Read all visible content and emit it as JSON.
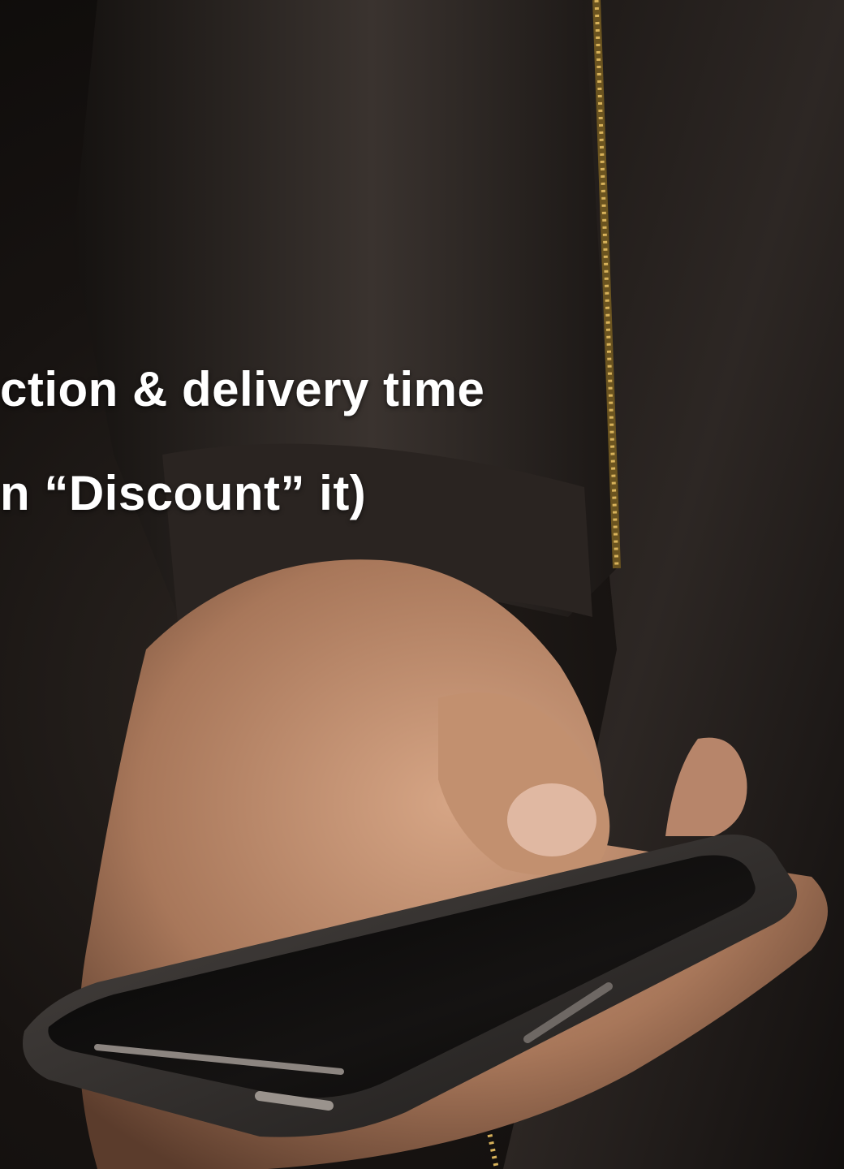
{
  "overlay_text": {
    "line1": "ction & delivery time",
    "line2": "n “Discount” it)"
  },
  "colors": {
    "background": "#0b0908",
    "text": "#ffffff",
    "jacket": "#1c1816",
    "skin": "#b78a6c",
    "phone": "#2b2826",
    "zipper": "#c8a04a"
  },
  "icons": [
    "smartphone-icon",
    "hand-icon",
    "zipper-icon"
  ]
}
